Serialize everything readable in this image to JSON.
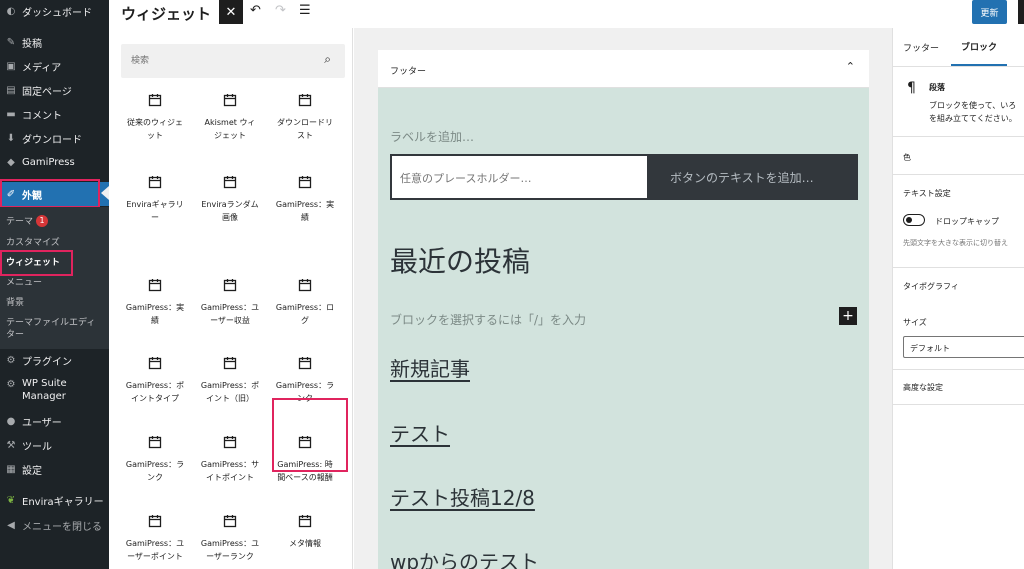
{
  "admin_menu": {
    "items": [
      {
        "label": "ダッシュボード",
        "icon": "dashboard-icon",
        "glyph": "◐"
      },
      {
        "label": "投稿",
        "icon": "pin-icon",
        "glyph": "✎"
      },
      {
        "label": "メディア",
        "icon": "media-icon",
        "glyph": "▣"
      },
      {
        "label": "固定ページ",
        "icon": "page-icon",
        "glyph": "▤"
      },
      {
        "label": "コメント",
        "icon": "comment-icon",
        "glyph": "▬"
      },
      {
        "label": "ダウンロード",
        "icon": "download-icon",
        "glyph": "⬇"
      },
      {
        "label": "GamiPress",
        "icon": "gamipress-icon",
        "glyph": "◆"
      },
      {
        "label": "外観",
        "icon": "brush-icon",
        "glyph": "✐"
      },
      {
        "label": "プラグイン",
        "icon": "plugin-icon",
        "glyph": "⚙"
      },
      {
        "label": "WP Suite",
        "label2": "Manager",
        "icon": "wpsuite-icon",
        "glyph": "⚙"
      },
      {
        "label": "ユーザー",
        "icon": "user-icon",
        "glyph": "●"
      },
      {
        "label": "ツール",
        "icon": "tool-icon",
        "glyph": "⚒"
      },
      {
        "label": "設定",
        "icon": "settings-icon",
        "glyph": "▦"
      },
      {
        "label": "Enviraギャラリー",
        "icon": "envira-icon",
        "glyph": "❦"
      },
      {
        "label": "メニューを閉じる",
        "icon": "collapse-icon",
        "glyph": "◀"
      }
    ],
    "submenu": [
      {
        "label": "テーマ"
      },
      {
        "label": "カスタマイズ"
      },
      {
        "label": "ウィジェット"
      },
      {
        "label": "メニュー"
      },
      {
        "label": "背景"
      },
      {
        "label": "テーマファイルエディ"
      },
      {
        "label": "ター"
      }
    ],
    "theme_badge": "1",
    "accent_color": "#2271b1",
    "highlight_color": "#e0245e"
  },
  "topbar": {
    "title": "ウィジェット",
    "close_glyph": "✕",
    "undo_glyph": "↶",
    "redo_glyph": "↷",
    "list_glyph": "☰",
    "update_label": "更新"
  },
  "inserter": {
    "search_placeholder": "検索",
    "search_glyph": "⌕",
    "blocks": [
      {
        "l1": "従来のウィジェ",
        "l2": "ット"
      },
      {
        "l1": "Akismet ウィ",
        "l2": "ジェット"
      },
      {
        "l1": "ダウンロードリ",
        "l2": "スト"
      },
      {
        "l1": "Enviraギャラリ",
        "l2": "ー"
      },
      {
        "l1": "Enviraランダム",
        "l2": "画像"
      },
      {
        "l1": "GamiPress：実",
        "l2": "績"
      },
      {
        "l1": "GamiPress：実",
        "l2": "績"
      },
      {
        "l1": "GamiPress：ユ",
        "l2": "ーザー収益"
      },
      {
        "l1": "GamiPress：ロ",
        "l2": "グ"
      },
      {
        "l1": "GamiPress：ポ",
        "l2": "イントタイプ"
      },
      {
        "l1": "GamiPress：ポ",
        "l2": "イント（旧）"
      },
      {
        "l1": "GamiPress：ラ",
        "l2": "ンク"
      },
      {
        "l1": "GamiPress：ラ",
        "l2": "ンク"
      },
      {
        "l1": "GamiPress：サ",
        "l2": "イトポイント"
      },
      {
        "l1": "GamiPress: 時",
        "l2": "間ベースの報酬"
      },
      {
        "l1": "GamiPress：ユ",
        "l2": "ーザーポイント"
      },
      {
        "l1": "GamiPress：ユ",
        "l2": "ーザーランク"
      },
      {
        "l1": "メタ情報",
        "l2": ""
      }
    ]
  },
  "canvas": {
    "area_title": "フッター",
    "chevron_glyph": "⌃",
    "add_label": "ラベルを追加…",
    "search_placeholder": "任意のプレースホルダー…",
    "search_button_text": "ボタンのテキストを追加…",
    "recent_posts_title": "最近の投稿",
    "block_prompt": "ブロックを選択するには「/」を入力",
    "plus_glyph": "+",
    "posts": [
      "新規記事",
      "テスト",
      "テスト投稿12/8",
      "wpからのテスト"
    ]
  },
  "settings": {
    "tab_footer": "フッター",
    "tab_block": "ブロック",
    "pilcrow": "¶",
    "block_name": "段落",
    "block_desc1": "ブロックを使って、いろ",
    "block_desc2": "を組み立ててください。",
    "color_label": "色",
    "text_settings_label": "テキスト設定",
    "dropcap_label": "ドロップキャップ",
    "dropcap_help": "先頭文字を大きな表示に切り替え",
    "typography_label": "タイポグラフィ",
    "size_label": "サイズ",
    "size_value": "デフォルト",
    "advanced_label": "高度な設定"
  }
}
